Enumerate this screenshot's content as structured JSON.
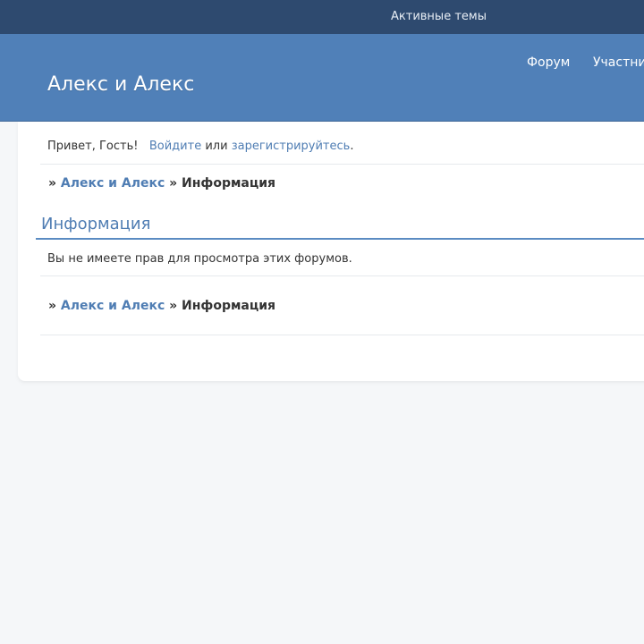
{
  "topbar": {
    "active_topics": "Активные темы"
  },
  "header": {
    "site_title": "Алекс и Алекс",
    "nav": {
      "forum": "Форум",
      "members": "Участни"
    }
  },
  "greeting": {
    "hello": "Привет, Гость!",
    "login": "Войдите",
    "or": "или",
    "register": "зарегистрируйтесь",
    "period": "."
  },
  "breadcrumb": {
    "separator": "»",
    "home": "Алекс и Алекс",
    "current": "Информация"
  },
  "section": {
    "title": "Информация",
    "message": "Вы не имеете прав для просмотра этих форумов."
  }
}
